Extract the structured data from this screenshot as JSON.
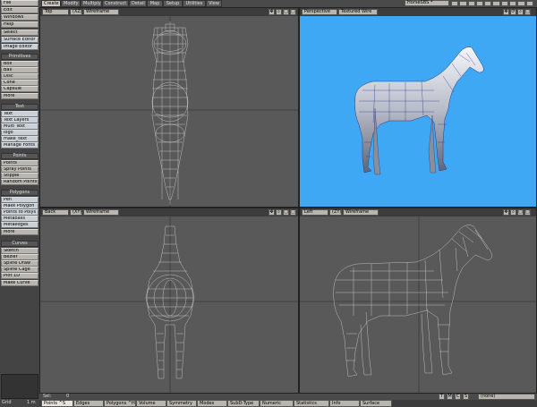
{
  "menu": {
    "tabs": [
      "Create",
      "Modify",
      "Multiply",
      "Construct",
      "Detail",
      "Map",
      "Setup",
      "Utilities",
      "View"
    ],
    "active_tab": "Create",
    "scene_name": "HorseSBS *"
  },
  "sidebar": {
    "top": [
      {
        "label": "File",
        "arrow": "▾"
      },
      {
        "label": "Edit",
        "arrow": "▾"
      },
      {
        "label": "Windows",
        "arrow": "▾"
      },
      {
        "label": "Help",
        "arrow": "▾"
      }
    ],
    "select": {
      "label": "Select",
      "arrow": "▾"
    },
    "surface_editor": "Surface Editor",
    "image_editor": "Image Editor",
    "primitives": {
      "title": "Primitives",
      "items": [
        "Box",
        "Ball",
        "Disc",
        "Cone",
        "Capsule"
      ],
      "more": "More"
    },
    "text": {
      "title": "Text",
      "items": [
        "Text",
        "Text Layers",
        "Multi Text",
        "logo",
        "make_text",
        "Manage Fonts"
      ]
    },
    "points": {
      "title": "Points",
      "items": [
        "Points",
        "Spray Points",
        "Stipple",
        "Random Points"
      ]
    },
    "polygons": {
      "title": "Polygons",
      "items": [
        "Pen",
        "Make Polygon",
        "Points to Polys",
        "Metaballs",
        "Metaedges"
      ],
      "more": "More"
    },
    "curves": {
      "title": "Curves",
      "items": [
        "Sketch",
        "Bezier",
        "Spline Draw",
        "Spline Cage",
        "Plot 1D",
        "Make Curve"
      ]
    },
    "grid_label": "Grid",
    "grid_value": "1 m"
  },
  "viewports": {
    "top_left": {
      "view": "Top",
      "axis": "(XZ)",
      "mode": "Wireframe"
    },
    "top_right": {
      "view": "Perspective",
      "mode": "Textured Wire"
    },
    "bottom_left": {
      "view": "Back",
      "axis": "(XY)",
      "mode": "Wireframe"
    },
    "bottom_right": {
      "view": "Left",
      "axis": "(ZY)",
      "mode": "Wireframe"
    }
  },
  "status": {
    "sel_label": "Sel:",
    "sel_value": "0",
    "mode_buttons": [
      "T",
      "M",
      "C",
      "S"
    ],
    "none_label": "(none)"
  },
  "bottom_tabs": [
    "Points",
    "Edges",
    "Polygons",
    "Volume",
    "Symmetry",
    "Modes",
    "SubD-Type",
    "Numeric",
    "Statistics",
    "Info",
    "Surface"
  ],
  "bottom_tab_arrows": [
    "^S",
    "",
    "^H",
    "",
    "",
    "",
    "",
    "",
    "",
    "",
    ""
  ],
  "colors": {
    "perspective_bg": "#3fa8f4",
    "wire_bg": "#595959",
    "ui_gray": "#b8b6ae"
  }
}
